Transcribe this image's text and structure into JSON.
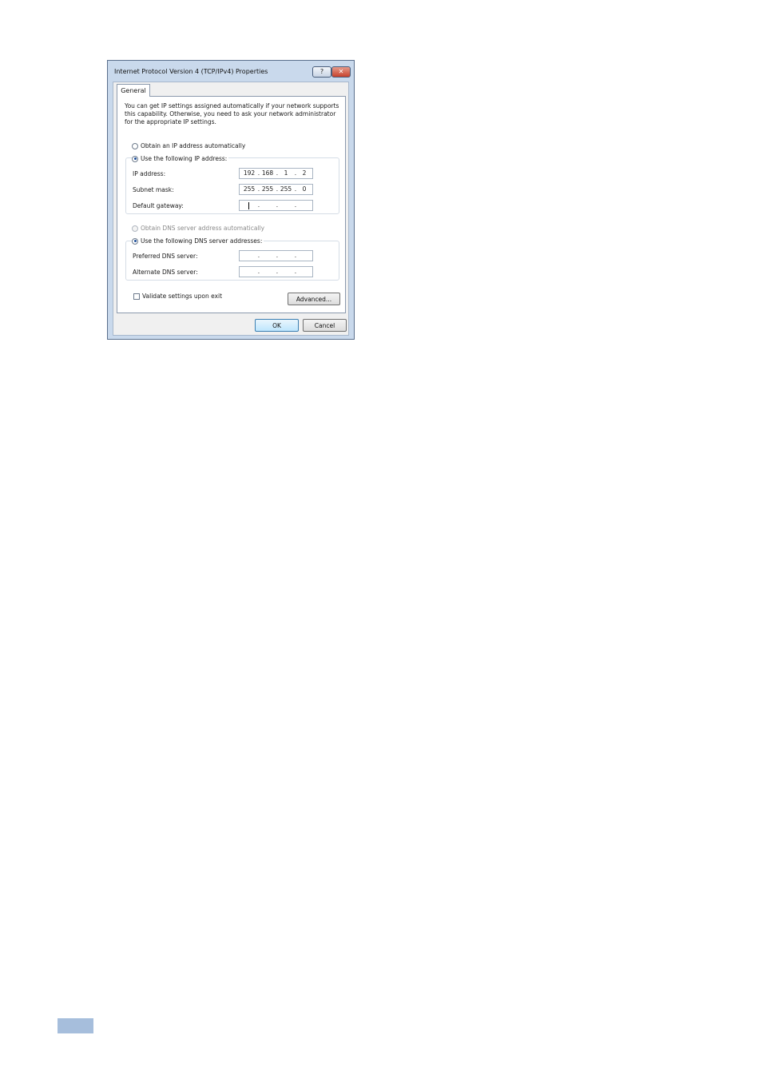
{
  "dialog": {
    "title": "Internet Protocol Version 4 (TCP/IPv4) Properties",
    "help_label": "?",
    "close_label": "✕",
    "tab_general": "General",
    "description_lines": [
      "You can get IP settings assigned automatically if your network supports",
      "this capability. Otherwise, you need to ask your network administrator",
      "for the appropriate IP settings."
    ],
    "ip_section": {
      "auto_label": "Obtain an IP address automatically",
      "manual_label": "Use the following IP address:",
      "selected": "manual",
      "ip_address": {
        "label": "IP address:",
        "octets": [
          "192",
          "168",
          "1",
          "2"
        ]
      },
      "subnet_mask": {
        "label": "Subnet mask:",
        "octets": [
          "255",
          "255",
          "255",
          "0"
        ]
      },
      "default_gateway": {
        "label": "Default gateway:",
        "octets": [
          "",
          "",
          "",
          ""
        ]
      }
    },
    "dns_section": {
      "auto_label": "Obtain DNS server address automatically",
      "manual_label": "Use the following DNS server addresses:",
      "selected": "manual",
      "auto_disabled": true,
      "preferred": {
        "label": "Preferred DNS server:",
        "octets": [
          "",
          "",
          "",
          ""
        ]
      },
      "alternate": {
        "label": "Alternate DNS server:",
        "octets": [
          "",
          "",
          "",
          ""
        ]
      }
    },
    "validate_label": "Validate settings upon exit",
    "validate_checked": false,
    "advanced_button": "Advanced...",
    "ok_button": "OK",
    "cancel_button": "Cancel"
  }
}
